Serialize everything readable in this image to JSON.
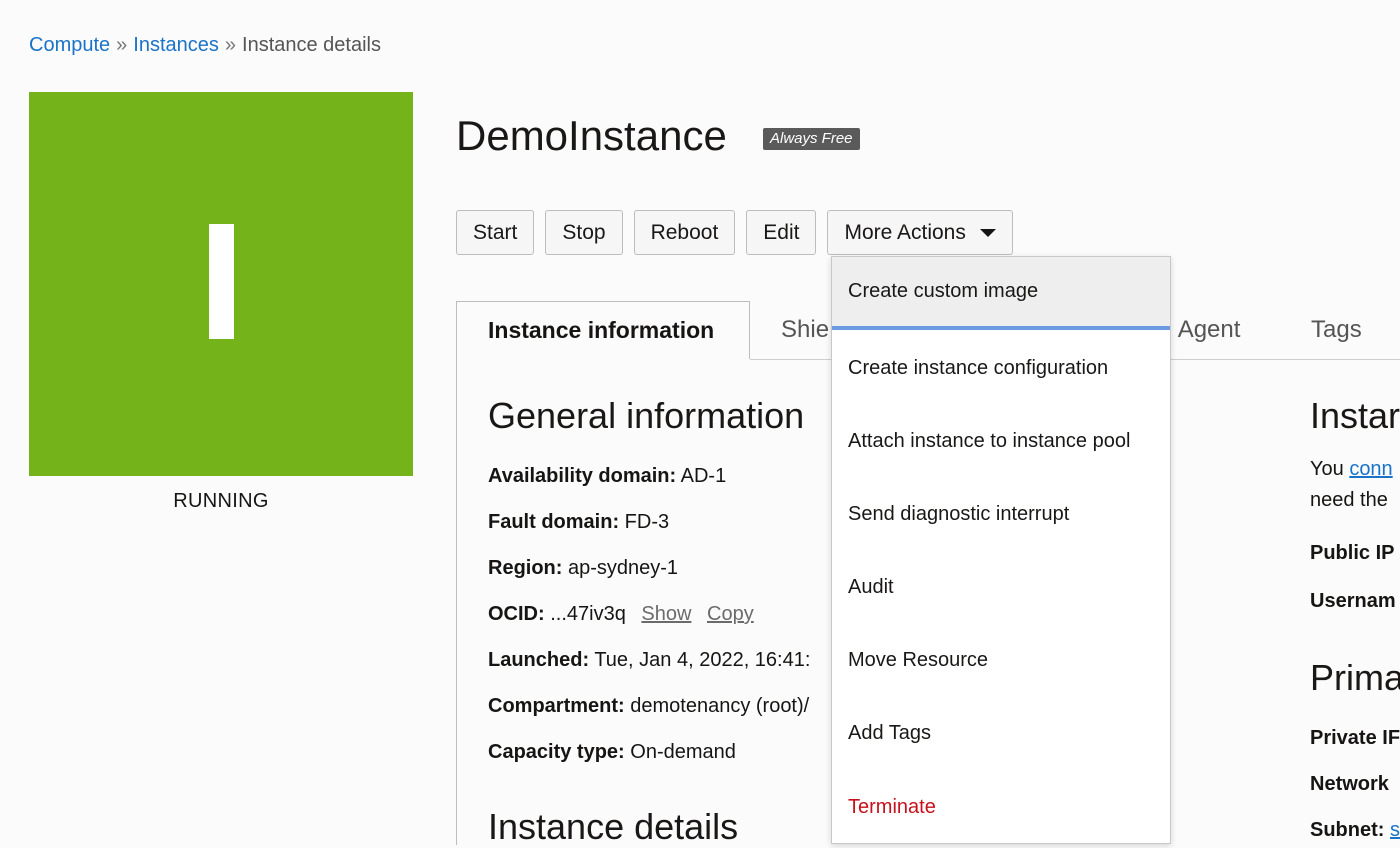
{
  "breadcrumb": {
    "compute": "Compute",
    "sep": "»",
    "instances": "Instances",
    "current": "Instance details"
  },
  "status": {
    "letter": "I",
    "label": "RUNNING",
    "color": "#74b319"
  },
  "instance": {
    "name": "DemoInstance",
    "badge": "Always Free"
  },
  "actions": {
    "start": "Start",
    "stop": "Stop",
    "reboot": "Reboot",
    "edit": "Edit",
    "more": "More Actions"
  },
  "tabs": [
    {
      "label": "Instance information",
      "active": true
    },
    {
      "label": "Shie"
    },
    {
      "label": "d Agent"
    },
    {
      "label": "Tags"
    }
  ],
  "general": {
    "heading": "General information",
    "availability_label": "Availability domain:",
    "availability_value": "AD-1",
    "fault_label": "Fault domain:",
    "fault_value": "FD-3",
    "region_label": "Region:",
    "region_value": "ap-sydney-1",
    "ocid_label": "OCID:",
    "ocid_value": "...47iv3q",
    "ocid_show": "Show",
    "ocid_copy": "Copy",
    "launched_label": "Launched:",
    "launched_value": "Tue, Jan 4, 2022, 16:41:",
    "compartment_label": "Compartment:",
    "compartment_value": "demotenancy (root)/",
    "capacity_label": "Capacity type:",
    "capacity_value": "On-demand"
  },
  "details_heading": "Instance details",
  "right_col": {
    "heading1": "Instar",
    "you": "You",
    "conn": "conn",
    "need": "need the",
    "public_ip": "Public IP",
    "username": "Usernam",
    "heading2": "Prima",
    "private_ip": "Private IF",
    "network": "Network",
    "subnet_label": "Subnet:",
    "subnet_link": "s"
  },
  "menu": {
    "items": [
      "Create custom image",
      "Create instance configuration",
      "Attach instance to instance pool",
      "Send diagnostic interrupt",
      "Audit",
      "Move Resource",
      "Add Tags",
      "Terminate"
    ]
  }
}
